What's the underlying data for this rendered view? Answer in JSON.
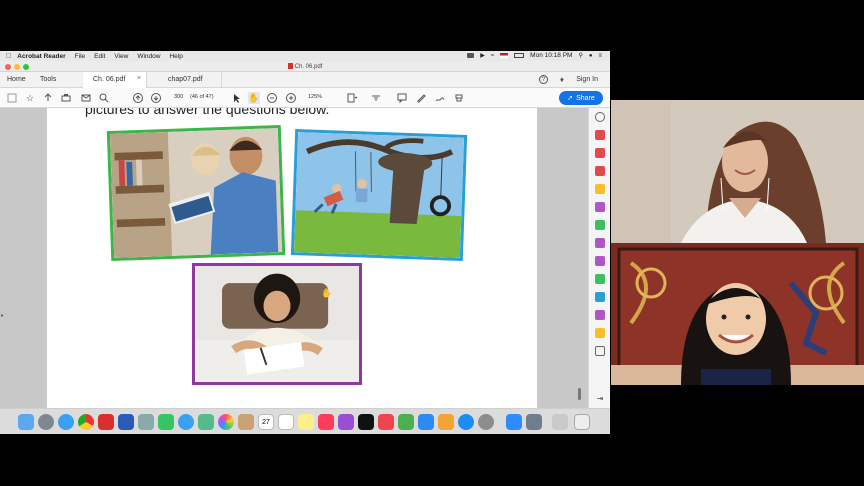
{
  "menubar": {
    "app_name": "Acrobat Reader",
    "items": [
      "File",
      "Edit",
      "View",
      "Window",
      "Help"
    ],
    "clock": "Mon 10:18 PM"
  },
  "window": {
    "title": "Ch. 06.pdf"
  },
  "tabs": {
    "home": "Home",
    "tools": "Tools",
    "docs": [
      {
        "label": "Ch. 06.pdf",
        "active": true
      },
      {
        "label": "chap07.pdf",
        "active": false
      }
    ],
    "sign_in": "Sign In"
  },
  "toolbar": {
    "page_number": "300",
    "page_count": "(46 of 47)",
    "zoom": "125%",
    "share_label": "Share"
  },
  "document": {
    "instruction_text": "pictures to answer the questions below."
  },
  "colors": {
    "share_blue": "#1473e6",
    "frame_green": "#3db54a",
    "frame_blue": "#2a9fd6",
    "frame_purple": "#8e3a9d"
  },
  "icons": {
    "toolbar": [
      "save-icon",
      "bookmark-icon",
      "upload-icon",
      "print-icon",
      "email-icon",
      "search-icon",
      "page-up-icon",
      "page-down-icon",
      "pointer-icon",
      "hand-icon",
      "zoom-out-icon",
      "zoom-in-icon",
      "fit-icon",
      "scroll-mode-icon",
      "comment-icon",
      "highlight-icon",
      "sign-icon",
      "stamp-icon"
    ]
  }
}
